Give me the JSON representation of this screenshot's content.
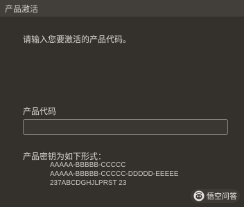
{
  "window": {
    "title": "产品激活"
  },
  "main": {
    "prompt": "请输入您要激活的产品代码。",
    "code_label": "产品代码",
    "code_value": "",
    "format_label": "产品密钥为如下形式：",
    "format_examples": [
      "AAAAA-BBBBB-CCCCC",
      "AAAAA-BBBBB-CCCCC-DDDDD-EEEEE",
      "237ABCDGHJLPRST 23"
    ]
  },
  "watermark": {
    "text": "悟空问答",
    "icon": "wukong-logo-icon"
  },
  "colors": {
    "background": "#34312d",
    "titlebar": "#423e39",
    "text": "#dcd9d4",
    "input_border": "#8b8782"
  }
}
